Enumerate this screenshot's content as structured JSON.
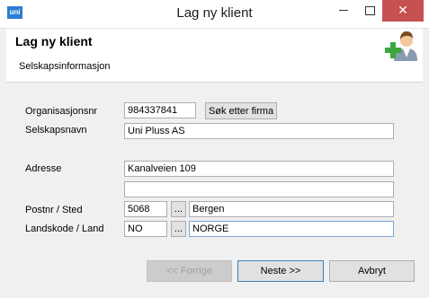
{
  "window": {
    "title": "Lag ny klient",
    "app_logo_text": "uni"
  },
  "header": {
    "title": "Lag ny klient",
    "subtitle": "Selskapsinformasjon",
    "icon": "user-add-icon"
  },
  "form": {
    "org_label": "Organisasjonsnr",
    "org_value": "984337841",
    "search_button": "Søk etter firma",
    "company_label": "Selskapsnavn",
    "company_value": "Uni Pluss AS",
    "address_label": "Adresse",
    "address1_value": "Kanalveien 109",
    "address2_value": "",
    "postal_label": "Postnr / Sted",
    "postal_code": "5068",
    "postal_browse": "...",
    "city": "Bergen",
    "country_label": "Landskode / Land",
    "country_code": "NO",
    "country_browse": "...",
    "country_name": "NORGE"
  },
  "buttons": {
    "previous": "<< Forrige",
    "next": "Neste >>",
    "cancel": "Avbryt"
  },
  "colors": {
    "close_button": "#c75050",
    "focus_border": "#7aa7d8",
    "dialog_background": "#f0f0f0"
  }
}
